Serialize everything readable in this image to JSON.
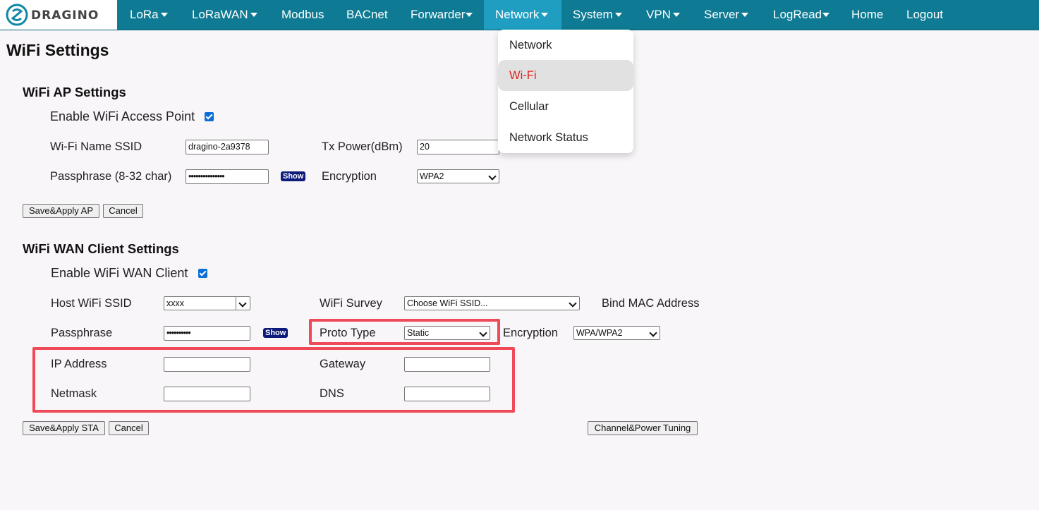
{
  "brand": {
    "logo_text": "DRAGINO"
  },
  "nav": {
    "items": [
      {
        "label": "LoRa",
        "has_caret": true
      },
      {
        "label": "LoRaWAN",
        "has_caret": true
      },
      {
        "label": "Modbus",
        "has_caret": false
      },
      {
        "label": "BACnet",
        "has_caret": false
      },
      {
        "label": "Forwarder",
        "has_caret": true
      },
      {
        "label": "Network",
        "has_caret": true,
        "active": true
      },
      {
        "label": "System",
        "has_caret": true
      },
      {
        "label": "VPN",
        "has_caret": true
      },
      {
        "label": "Server",
        "has_caret": true
      },
      {
        "label": "LogRead",
        "has_caret": true
      },
      {
        "label": "Home",
        "has_caret": false
      },
      {
        "label": "Logout",
        "has_caret": false
      }
    ],
    "dropdown": [
      {
        "label": "Network"
      },
      {
        "label": "Wi-Fi",
        "selected": true
      },
      {
        "label": "Cellular"
      },
      {
        "label": "Network Status"
      }
    ]
  },
  "page": {
    "title": "WiFi Settings",
    "ap": {
      "heading": "WiFi AP Settings",
      "enable_label": "Enable WiFi Access Point",
      "enable_checked": true,
      "ssid_label": "Wi-Fi Name SSID",
      "ssid_value": "dragino-2a9378",
      "txpower_label": "Tx Power(dBm)",
      "txpower_value": "20",
      "pass_label": "Passphrase (8-32 char)",
      "pass_value": "•••••••••••••••",
      "show_label": "Show",
      "enc_label": "Encryption",
      "enc_value": "WPA2",
      "save_label": "Save&Apply AP",
      "cancel_label": "Cancel"
    },
    "sta": {
      "heading": "WiFi WAN Client Settings",
      "enable_label": "Enable WiFi WAN Client",
      "enable_checked": true,
      "host_ssid_label": "Host WiFi SSID",
      "host_ssid_value": "xxxx",
      "survey_label": "WiFi Survey",
      "survey_value": "Choose WiFi SSID...",
      "bind_mac_label": "Bind MAC Address",
      "pass_label": "Passphrase",
      "pass_value": "••••••••••",
      "show_label": "Show",
      "proto_label": "Proto Type",
      "proto_value": "Static",
      "enc_label": "Encryption",
      "enc_value": "WPA/WPA2",
      "ip_label": "IP Address",
      "ip_value": "",
      "gateway_label": "Gateway",
      "gateway_value": "",
      "netmask_label": "Netmask",
      "netmask_value": "",
      "dns_label": "DNS",
      "dns_value": "",
      "save_label": "Save&Apply STA",
      "cancel_label": "Cancel",
      "tuning_label": "Channel&Power Tuning"
    }
  },
  "colors": {
    "nav_bg": "#0e7a93",
    "nav_active": "#1f9ec2",
    "highlight": "#ee4a57",
    "selected_text": "#e02020"
  }
}
